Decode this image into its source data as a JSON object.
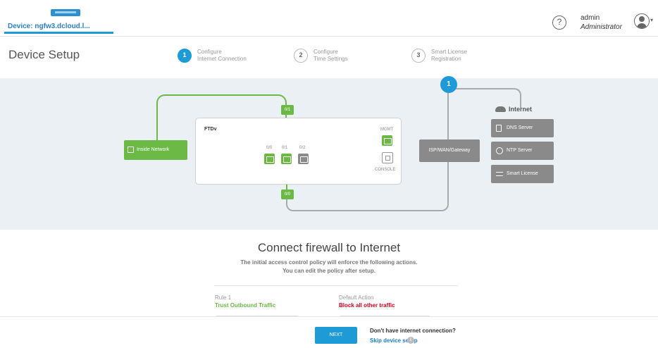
{
  "header": {
    "device_label": "Device: ngfw3.dcloud.l...",
    "help_glyph": "?",
    "user": {
      "name": "admin",
      "role": "Administrator"
    }
  },
  "setup": {
    "title": "Device Setup",
    "steps": [
      {
        "number": "1",
        "line1": "Configure",
        "line2": "Internet Connection",
        "active": true
      },
      {
        "number": "2",
        "line1": "Configure",
        "line2": "Time Settings",
        "active": false
      },
      {
        "number": "3",
        "line1": "Smart License",
        "line2": "Registration",
        "active": false
      }
    ]
  },
  "diagram": {
    "inside_network": "Inside Network",
    "ftdv_label": "FTDv",
    "port_labels": [
      "0/0",
      "0/1",
      "0/2"
    ],
    "mgmt_label": "MGMT",
    "console_label": "CONSOLE",
    "tag_top": "0/1",
    "tag_bottom": "0/0",
    "isp_label": "ISP/WAN/Gateway",
    "step_marker": "1",
    "internet_label": "Internet",
    "services": [
      {
        "label": "DNS Server",
        "icon": "server-icon"
      },
      {
        "label": "NTP Server",
        "icon": "clock-icon"
      },
      {
        "label": "Smart License",
        "icon": "license-icon"
      }
    ],
    "colors": {
      "active": "#6cb946",
      "inactive": "#8a8a8a",
      "accent": "#1e9bd7"
    }
  },
  "policy": {
    "heading": "Connect firewall to Internet",
    "note_line1": "The initial access control policy will enforce the following actions.",
    "note_line2": "You can edit the policy after setup.",
    "rule_label": "Rule 1",
    "rule_value": "Trust Outbound Traffic",
    "default_label": "Default Action",
    "default_value": "Block all other traffic"
  },
  "footer": {
    "next_label": "NEXT",
    "no_connection": "Don't have internet connection?",
    "skip_label": "Skip device setup",
    "info_glyph": "i"
  }
}
